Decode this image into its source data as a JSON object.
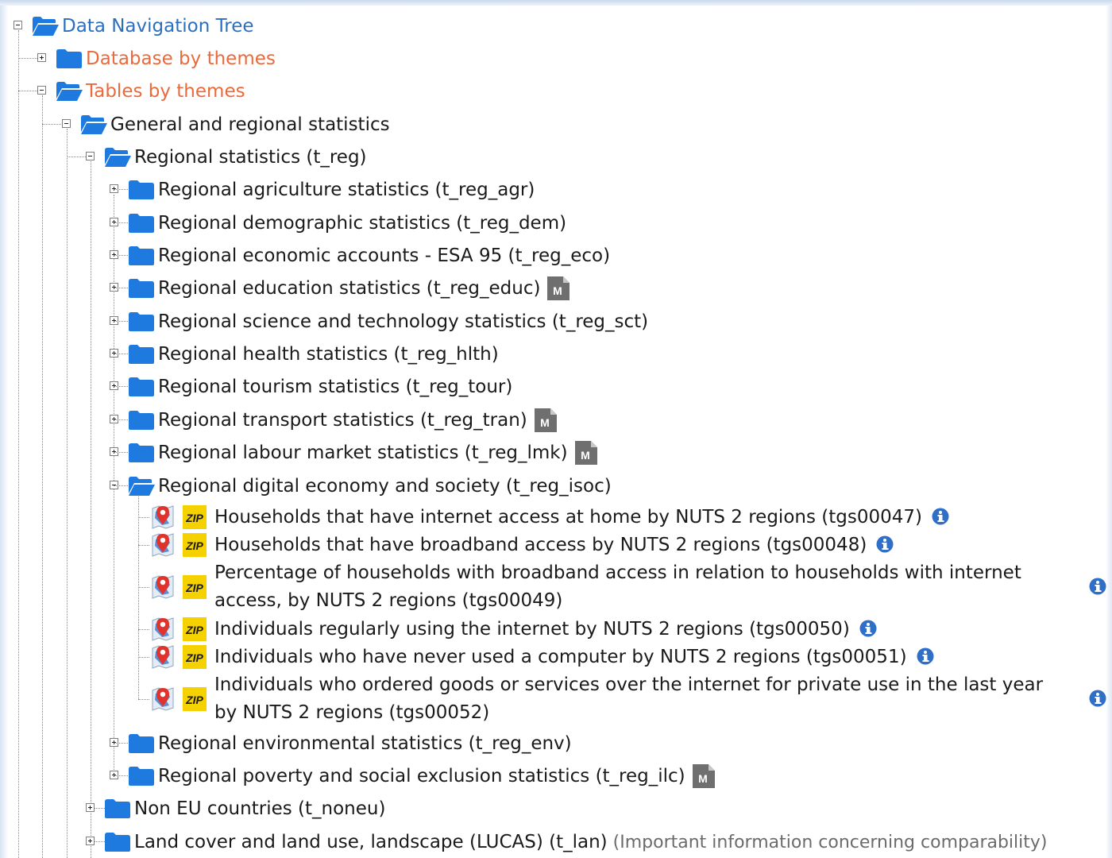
{
  "tree": {
    "root": {
      "label": "Data Navigation Tree",
      "icon": "folder-open-icon"
    },
    "database_by_themes": {
      "label": "Database by themes",
      "icon": "folder-icon"
    },
    "tables_by_themes": {
      "label": "Tables by themes",
      "icon": "folder-open-icon"
    },
    "general_regional": {
      "label": "General and regional statistics",
      "icon": "folder-open-icon"
    },
    "regional_statistics": {
      "label": "Regional statistics (t_reg)",
      "icon": "folder-open-icon"
    },
    "children": [
      {
        "label": "Regional agriculture statistics (t_reg_agr)",
        "metadata": false
      },
      {
        "label": "Regional demographic statistics (t_reg_dem)",
        "metadata": false
      },
      {
        "label": "Regional economic accounts - ESA 95 (t_reg_eco)",
        "metadata": false
      },
      {
        "label": "Regional education statistics (t_reg_educ)",
        "metadata": true
      },
      {
        "label": "Regional science and technology statistics (t_reg_sct)",
        "metadata": false
      },
      {
        "label": "Regional health statistics (t_reg_hlth)",
        "metadata": false
      },
      {
        "label": "Regional tourism statistics (t_reg_tour)",
        "metadata": false
      },
      {
        "label": "Regional transport statistics (t_reg_tran)",
        "metadata": true
      },
      {
        "label": "Regional labour market statistics (t_reg_lmk)",
        "metadata": true
      }
    ],
    "digital": {
      "label": "Regional digital economy and society (t_reg_isoc)",
      "datasets": [
        {
          "text": "Households that have internet access at home by NUTS 2 regions (tgs00047)"
        },
        {
          "text": "Households that have broadband access by NUTS 2 regions (tgs00048)"
        },
        {
          "text": "Percentage of households with broadband access in relation to households with internet access, by NUTS 2 regions (tgs00049)"
        },
        {
          "text": "Individuals regularly using the internet by NUTS 2 regions (tgs00050)"
        },
        {
          "text": "Individuals who have never used a computer by NUTS 2 regions (tgs00051)"
        },
        {
          "text": "Individuals who ordered goods or services over the internet for private use in the last year by NUTS 2 regions (tgs00052)"
        }
      ]
    },
    "after": [
      {
        "label": "Regional environmental statistics (t_reg_env)",
        "metadata": false
      },
      {
        "label": "Regional poverty and social exclusion statistics (t_reg_ilc)",
        "metadata": true
      }
    ],
    "non_eu": {
      "label": "Non EU countries (t_noneu)"
    },
    "lucas": {
      "label": "Land cover and land use, landscape (LUCAS) (t_lan)",
      "note": "(Important information concerning comparability)"
    }
  },
  "icons": {
    "zip_label": "ZIP",
    "metadata_label": "M",
    "folder_color": "#1f7ae0",
    "zip_color": "#f5d100",
    "info_color": "#2f6fc8",
    "root_text_color": "#2a6fc0",
    "theme_text_color": "#ea6a3b"
  }
}
